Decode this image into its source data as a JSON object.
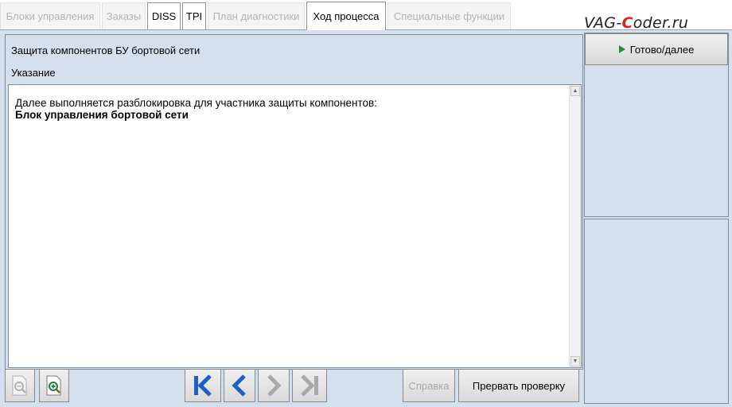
{
  "tabs": [
    {
      "label": "Блоки управления",
      "state": "disabled"
    },
    {
      "label": "Заказы",
      "state": "disabled"
    },
    {
      "label": "DISS",
      "state": "enabled"
    },
    {
      "label": "TPI",
      "state": "enabled"
    },
    {
      "label": "План диагностики",
      "state": "disabled"
    },
    {
      "label": "Ход процесса",
      "state": "active"
    },
    {
      "label": "Специальные функции",
      "state": "disabled"
    }
  ],
  "watermark": {
    "prefix": "VAG-",
    "accent": "C",
    "suffix": "oder.ru"
  },
  "panel": {
    "title": "Защита компонентов БУ бортовой сети",
    "subtitle": "Указание"
  },
  "message": {
    "line1": "Далее выполняется разблокировка для участника защиты компонентов:",
    "line2": "Блок управления бортовой сети"
  },
  "actions": {
    "next_label": "Готово/далее"
  },
  "toolbar": {
    "zoom_out_icon": "zoom-out-icon",
    "zoom_in_icon": "zoom-in-icon",
    "first_icon": "skip-to-first-icon",
    "prev_icon": "chevron-left-icon",
    "next_icon": "chevron-right-icon",
    "last_icon": "skip-to-last-icon",
    "help_label": "Справка",
    "abort_label": "Прервать проверку"
  },
  "colors": {
    "panel_bg": "#d5e0ee",
    "nav_active": "#1f5fc4",
    "nav_disabled": "#a9a9a9",
    "play": "#2a8a2a",
    "watermark_accent": "#e02020"
  }
}
